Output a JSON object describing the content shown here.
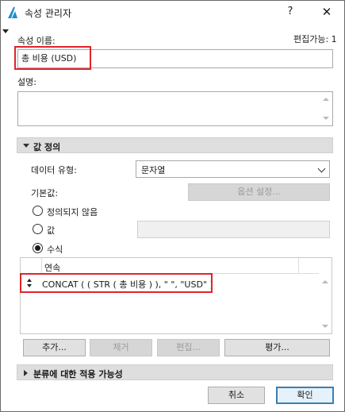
{
  "window": {
    "title": "속성 관리자",
    "help_label": "?",
    "close_label": "✕"
  },
  "name_section": {
    "label": "속성 이름:",
    "editable_text": "편집가능: 1",
    "value": "총 비용 (USD)"
  },
  "description": {
    "label": "설명:",
    "value": ""
  },
  "value_definition": {
    "header": "값 정의",
    "data_type_label": "데이터 유형:",
    "data_type_value": "문자열",
    "default_label": "기본값:",
    "options_button": "옵션 설정...",
    "radios": [
      {
        "label": "정의되지 않음",
        "selected": false
      },
      {
        "label": "값",
        "selected": false
      },
      {
        "label": "수식",
        "selected": true
      }
    ],
    "expression": {
      "column_header": "연속",
      "formula": "CONCAT ( ( STR ( 총 비용 ) ), \" \", \"USD\" )"
    },
    "buttons": {
      "add": "추가...",
      "remove": "제거",
      "edit": "편집...",
      "evaluate": "평가..."
    }
  },
  "classification_section": {
    "header": "분류에 대한 적용 가능성"
  },
  "footer": {
    "cancel": "취소",
    "ok": "확인"
  },
  "colors": {
    "highlight_red": "#e0242b",
    "accent_blue": "#3c7fb1",
    "section_bg": "#dedede"
  }
}
